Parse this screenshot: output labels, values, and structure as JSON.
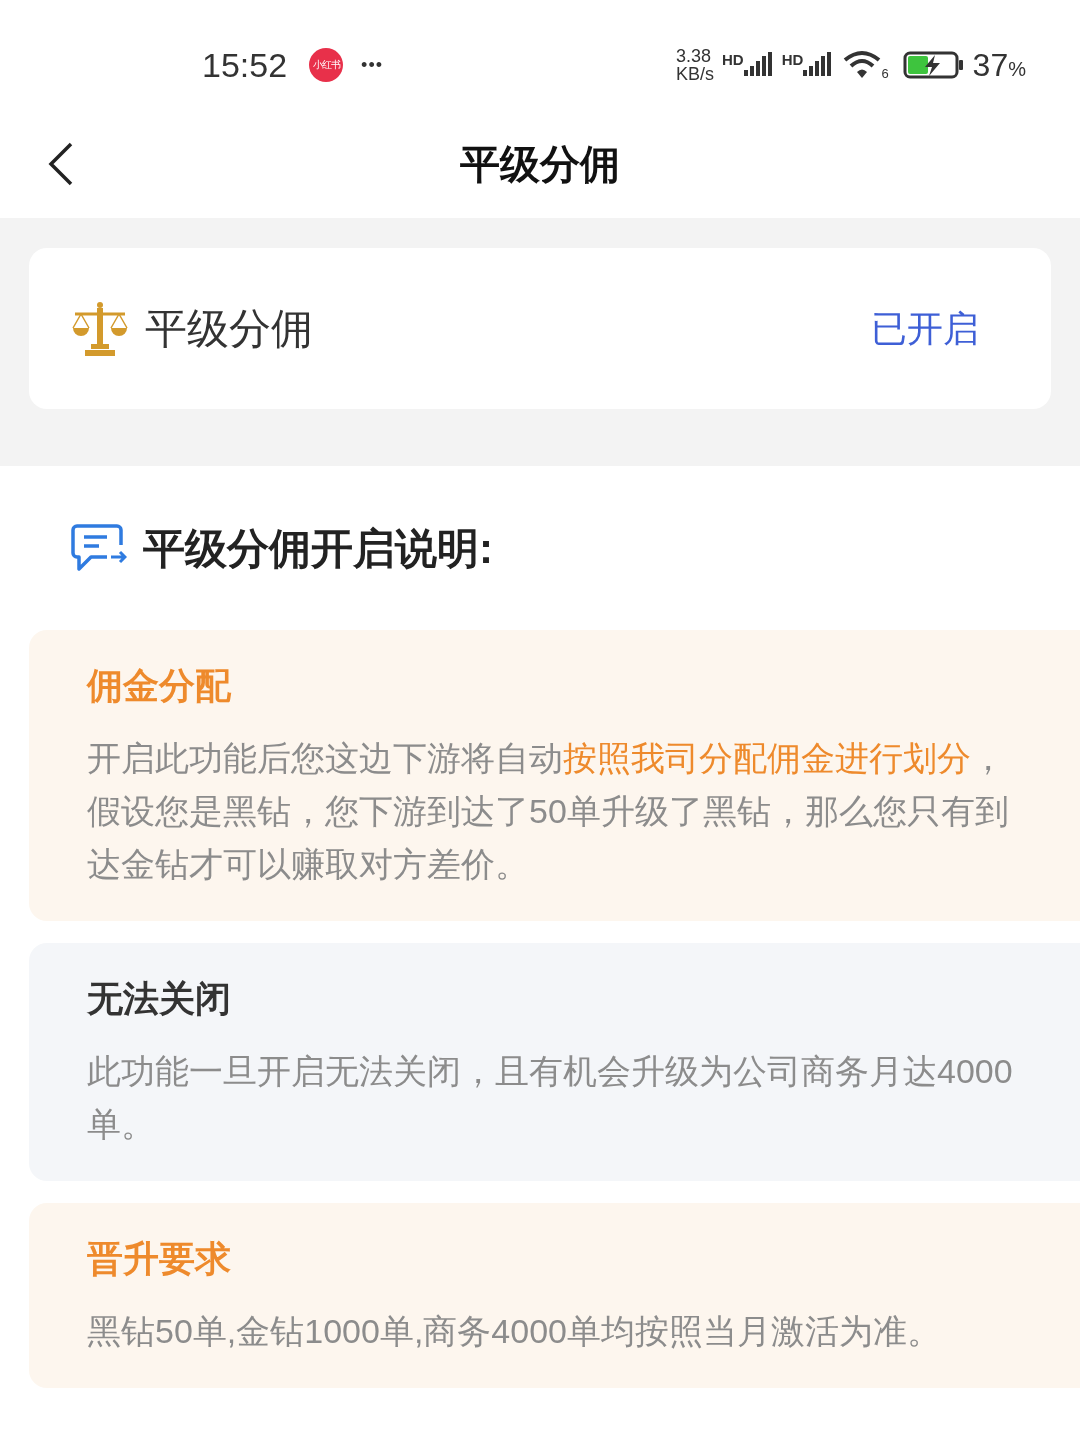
{
  "status_bar": {
    "time": "15:52",
    "app_badge": "小红书",
    "more": "•••",
    "speed_value": "3.38",
    "speed_unit": "KB/s",
    "sim_labels": [
      "HD",
      "HD"
    ],
    "wifi_label": "6",
    "battery": "37",
    "battery_unit": "%"
  },
  "header": {
    "title": "平级分佣"
  },
  "feature": {
    "label": "平级分佣",
    "status": "已开启"
  },
  "explanation": {
    "title": "平级分佣开启说明:",
    "cards": [
      {
        "kind": "highlight",
        "title": "佣金分配",
        "segments": [
          {
            "text": "开启此功能后您这边下游将自动",
            "highlight": false
          },
          {
            "text": "按照我司分配佣金进行划分",
            "highlight": true
          },
          {
            "text": "，假设您是黑钻，您下游到达了50单升级了黑钻，那么您只有到达金钻才可以赚取对方差价。",
            "highlight": false
          }
        ]
      },
      {
        "kind": "plain",
        "title": "无法关闭",
        "segments": [
          {
            "text": "此功能一旦开启无法关闭，且有机会升级为公司商务月达4000单。",
            "highlight": false
          }
        ]
      },
      {
        "kind": "highlight",
        "title": "晋升要求",
        "segments": [
          {
            "text": "黑钻50单,金钻1000单,商务4000单均按照当月激活为准。",
            "highlight": false
          }
        ]
      }
    ]
  }
}
